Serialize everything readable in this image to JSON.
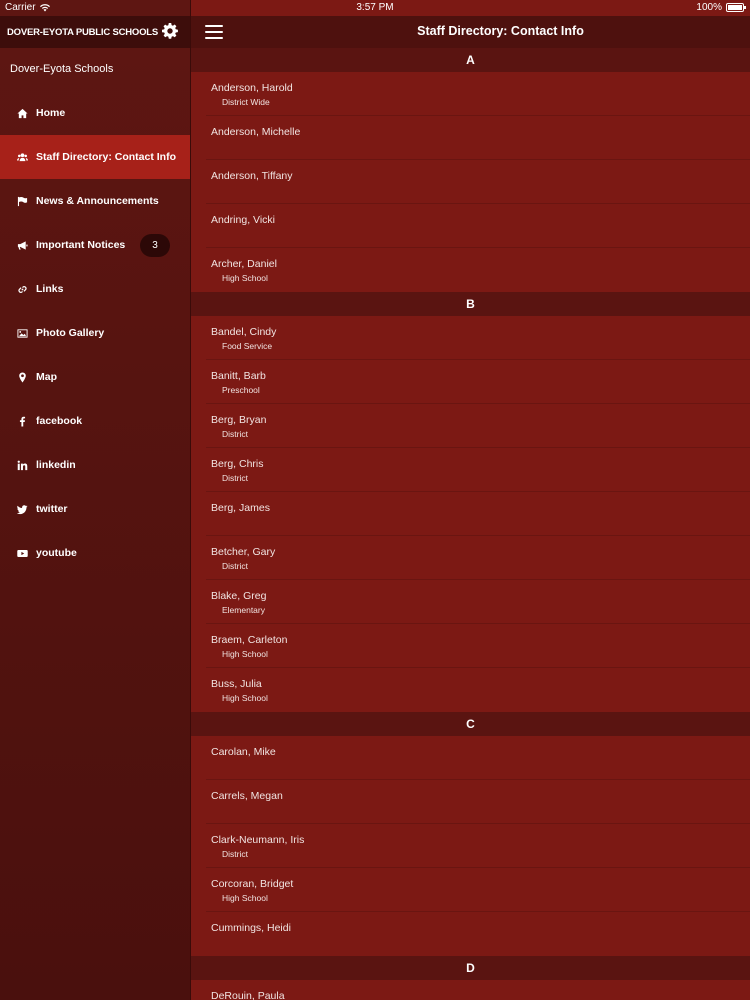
{
  "status_bar": {
    "carrier": "Carrier",
    "time": "3:57 PM",
    "battery": "100%"
  },
  "sidebar": {
    "app_title": "DOVER-EYOTA PUBLIC SCHOOLS",
    "subtitle": "Dover-Eyota Schools",
    "items": [
      {
        "label": "Home",
        "icon": "home-icon"
      },
      {
        "label": "Staff Directory: Contact Info",
        "icon": "users-icon",
        "active": true
      },
      {
        "label": "News & Announcements",
        "icon": "flag-icon"
      },
      {
        "label": "Important Notices",
        "icon": "megaphone-icon",
        "badge": "3"
      },
      {
        "label": "Links",
        "icon": "link-icon"
      },
      {
        "label": "Photo Gallery",
        "icon": "image-icon"
      },
      {
        "label": "Map",
        "icon": "map-pin-icon"
      },
      {
        "label": "facebook",
        "icon": "facebook-icon"
      },
      {
        "label": "linkedin",
        "icon": "linkedin-icon"
      },
      {
        "label": "twitter",
        "icon": "twitter-icon"
      },
      {
        "label": "youtube",
        "icon": "youtube-icon"
      }
    ]
  },
  "main": {
    "title": "Staff Directory: Contact Info",
    "sections": [
      {
        "letter": "A",
        "entries": [
          {
            "name": "Anderson, Harold",
            "dept": "District Wide"
          },
          {
            "name": "Anderson, Michelle",
            "dept": ""
          },
          {
            "name": "Anderson, Tiffany",
            "dept": ""
          },
          {
            "name": "Andring, Vicki",
            "dept": ""
          },
          {
            "name": "Archer, Daniel",
            "dept": "High School"
          }
        ]
      },
      {
        "letter": "B",
        "entries": [
          {
            "name": "Bandel, Cindy",
            "dept": "Food Service"
          },
          {
            "name": "Banitt, Barb",
            "dept": "Preschool"
          },
          {
            "name": "Berg, Bryan",
            "dept": "District"
          },
          {
            "name": "Berg, Chris",
            "dept": "District"
          },
          {
            "name": "Berg, James",
            "dept": ""
          },
          {
            "name": "Betcher, Gary",
            "dept": "District"
          },
          {
            "name": "Blake, Greg",
            "dept": "Elementary"
          },
          {
            "name": "Braem, Carleton",
            "dept": "High School"
          },
          {
            "name": "Buss, Julia",
            "dept": "High School"
          }
        ]
      },
      {
        "letter": "C",
        "entries": [
          {
            "name": "Carolan, Mike",
            "dept": ""
          },
          {
            "name": "Carrels, Megan",
            "dept": ""
          },
          {
            "name": "Clark-Neumann, Iris",
            "dept": "District"
          },
          {
            "name": "Corcoran, Bridget",
            "dept": "High School"
          },
          {
            "name": "Cummings, Heidi",
            "dept": ""
          }
        ]
      },
      {
        "letter": "D",
        "entries": [
          {
            "name": "DeRouin, Paula",
            "dept": ""
          }
        ]
      }
    ]
  },
  "colors": {
    "accent_active": "#a72119",
    "background": "#7c1914",
    "header": "#4e110e"
  }
}
